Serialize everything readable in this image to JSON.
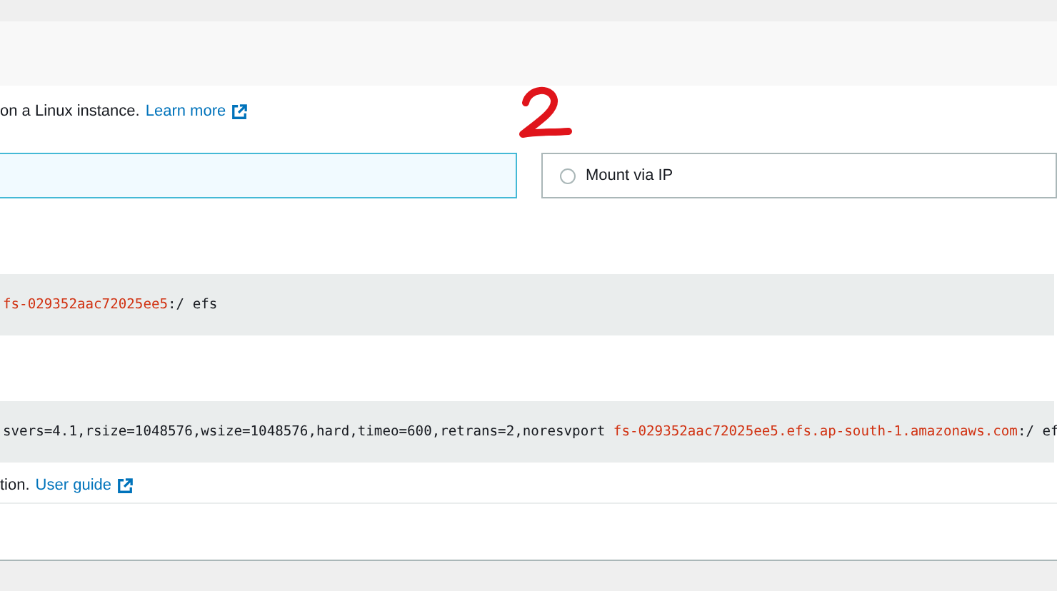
{
  "intro": {
    "text": "on a Linux instance.",
    "link": "Learn more"
  },
  "mount_options": [
    {
      "selected": true
    },
    {
      "label": "Mount via IP",
      "selected": false
    }
  ],
  "commands": [
    [
      {
        "kind": "highlight",
        "text": "fs-029352aac72025ee5"
      },
      {
        "kind": "plain",
        "text": ":/ efs"
      }
    ],
    [
      {
        "kind": "plain",
        "text": "svers=4.1,rsize=1048576,wsize=1048576,hard,timeo=600,retrans=2,noresvport "
      },
      {
        "kind": "highlight",
        "text": "fs-029352aac72025ee5.efs.ap-south-1.amazonaws.com"
      },
      {
        "kind": "plain",
        "text": ":/ ef"
      }
    ]
  ],
  "footer_note": {
    "text": "tion.",
    "link": "User guide"
  }
}
